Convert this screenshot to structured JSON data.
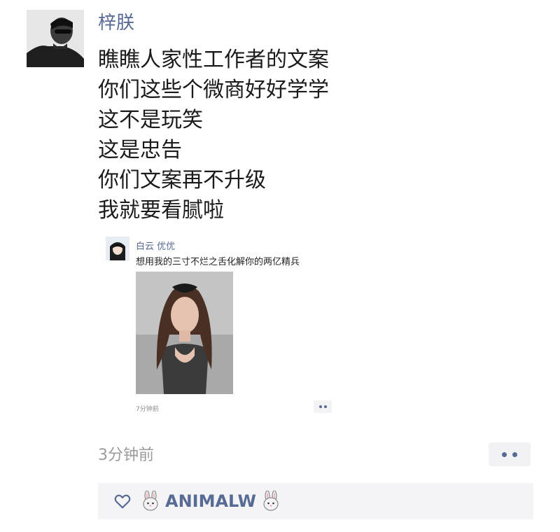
{
  "post": {
    "author": "梓朕",
    "lines": [
      "瞧瞧人家性工作者的文案",
      "你们这些个微商好好学学",
      "这不是玩笑",
      "这是忠告",
      "你们文案再不升级",
      "我就要看腻啦"
    ],
    "timestamp": "3分钟前",
    "more_icon": "more-dots-icon"
  },
  "embedded_post": {
    "author": "白云 优优",
    "text": "想用我的三寸不烂之舌化解你的两亿精兵",
    "timestamp": "7分钟前"
  },
  "likes": {
    "icon": "heart-icon",
    "liker_name": "ANIMALW",
    "emoji_icon": "rabbit-icon"
  },
  "colors": {
    "link_blue": "#576b95",
    "bar_bg": "#f4f4f6"
  }
}
